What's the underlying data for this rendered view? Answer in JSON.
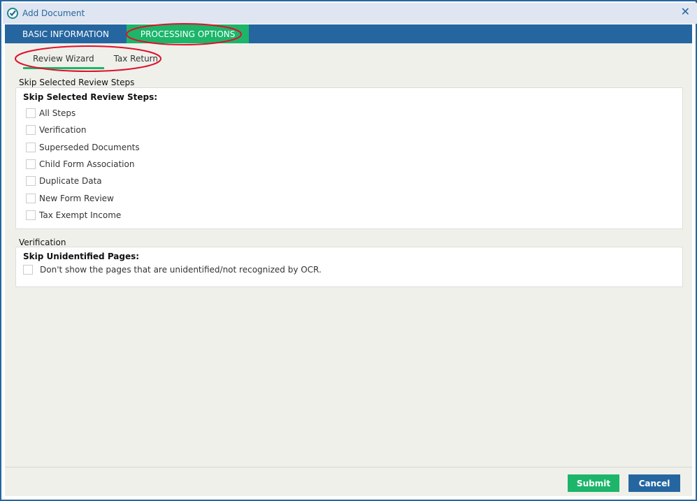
{
  "window": {
    "title": "Add Document"
  },
  "tabs": [
    {
      "label": "BASIC INFORMATION"
    },
    {
      "label": "PROCESSING OPTIONS",
      "active": true
    }
  ],
  "subtabs": [
    {
      "label": "Review Wizard",
      "active": true
    },
    {
      "label": "Tax Return"
    }
  ],
  "section1": {
    "label": "Skip Selected Review Steps",
    "heading": "Skip Selected Review Steps:",
    "items": [
      {
        "label": "All Steps",
        "checked": false
      },
      {
        "label": "Verification",
        "checked": false
      },
      {
        "label": "Superseded Documents",
        "checked": false
      },
      {
        "label": "Child Form Association",
        "checked": false
      },
      {
        "label": "Duplicate Data",
        "checked": false
      },
      {
        "label": "New Form Review",
        "checked": false
      },
      {
        "label": "Tax Exempt Income",
        "checked": false
      }
    ]
  },
  "section2": {
    "label": "Verification",
    "heading": "Skip Unidentified Pages:",
    "items": [
      {
        "label": "Don't show the pages that are unidentified/not recognized by OCR.",
        "checked": false
      }
    ]
  },
  "buttons": {
    "submit": "Submit",
    "cancel": "Cancel"
  },
  "colors": {
    "primary": "#2566a0",
    "accent": "#1cb56a",
    "annotation": "#e0102a"
  }
}
